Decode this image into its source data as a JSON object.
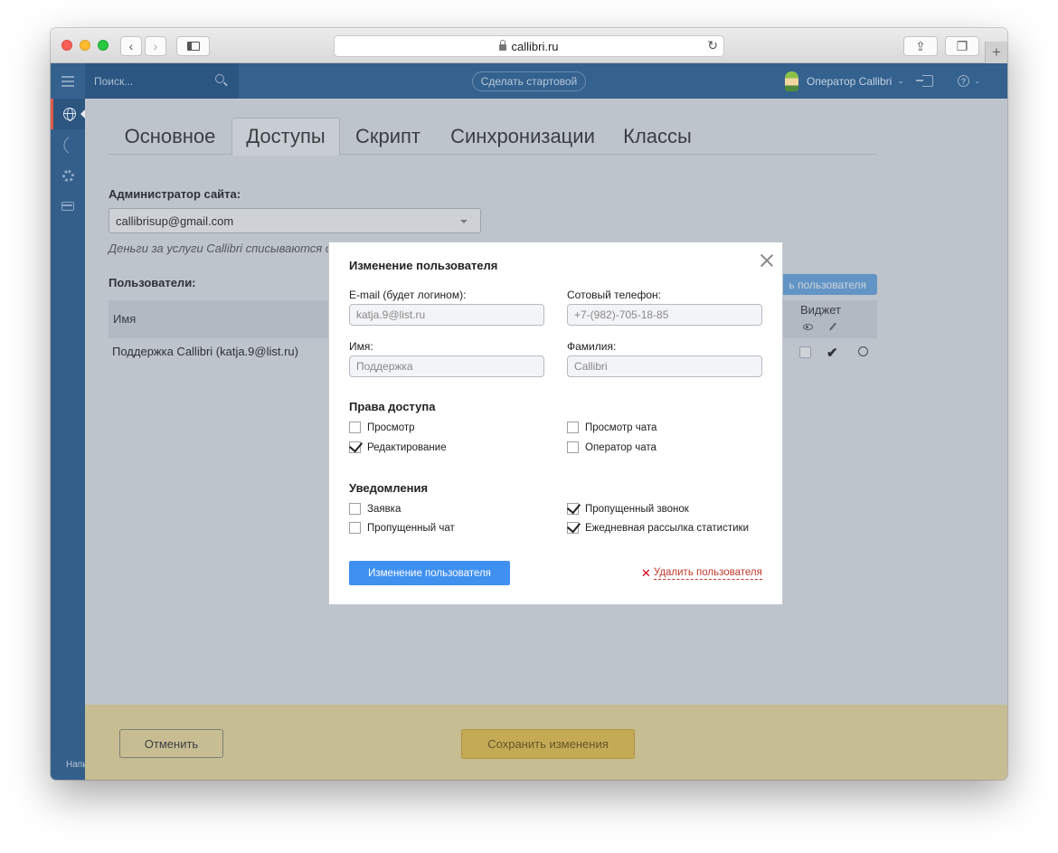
{
  "browser": {
    "url": "callibri.ru"
  },
  "topbar": {
    "search_placeholder": "Поиск...",
    "start_button": "Сделать стартовой",
    "operator_name": "Оператор Callibri"
  },
  "sidebar": {
    "footer_text": "Напи"
  },
  "tabs": [
    "Основное",
    "Доступы",
    "Скрипт",
    "Синхронизации",
    "Классы"
  ],
  "active_tab": "Доступы",
  "admin": {
    "label": "Администратор сайта:",
    "value": "callibrisup@gmail.com",
    "billing_note": "Деньги за услуги Callibri списываются с ак"
  },
  "users": {
    "label": "Пользователи:",
    "add_button": "ь пользователя",
    "col_name": "Имя",
    "col_widget": "Виджет",
    "rows": [
      {
        "name": "Поддержка Callibri (katja.9@list.ru)"
      }
    ]
  },
  "footer": {
    "cancel": "Отменить",
    "save": "Сохранить изменения"
  },
  "modal": {
    "title": "Изменение пользователя",
    "email_label": "E-mail (будет логином):",
    "email_value": "katja.9@list.ru",
    "phone_label": "Сотовый телефон:",
    "phone_value": "+7-(982)-705-18-85",
    "first_name_label": "Имя:",
    "first_name_value": "Поддержка",
    "last_name_label": "Фамилия:",
    "last_name_value": "Callibri",
    "rights_title": "Права доступа",
    "rights": [
      {
        "label": "Просмотр",
        "checked": false
      },
      {
        "label": "Редактирование",
        "checked": true
      },
      {
        "label": "Просмотр чата",
        "checked": false
      },
      {
        "label": "Оператор чата",
        "checked": false
      }
    ],
    "notifications_title": "Уведомления",
    "notifications": [
      {
        "label": "Заявка",
        "checked": false
      },
      {
        "label": "Пропущенный чат",
        "checked": false
      },
      {
        "label": "Пропущенный звонок",
        "checked": true
      },
      {
        "label": "Ежедневная рассылка статистики",
        "checked": true
      }
    ],
    "submit_button": "Изменение пользователя",
    "delete_link": "Удалить пользователя"
  }
}
